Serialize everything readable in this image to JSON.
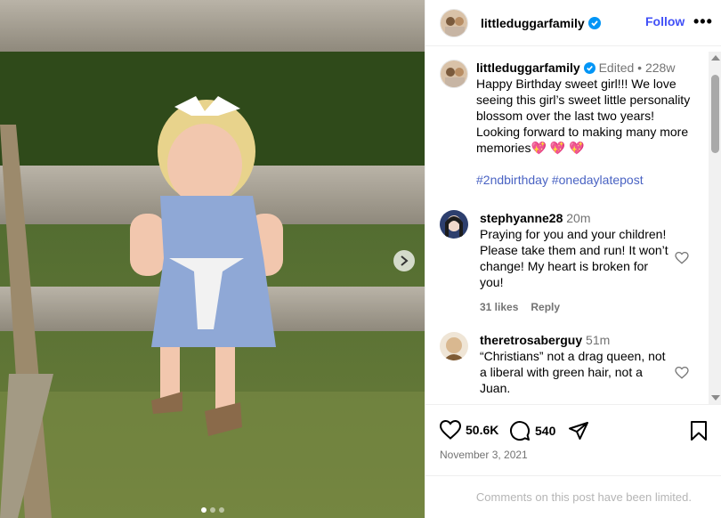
{
  "post": {
    "username": "littleduggarfamily",
    "follow_label": "Follow",
    "more_label": "•••"
  },
  "caption": {
    "username": "littleduggarfamily",
    "edited": "Edited",
    "separator": "•",
    "age": "228w",
    "text": "Happy Birthday sweet girl!!! We love seeing this girl’s sweet little personality blossom over the last two years! Looking forward to making many more memories",
    "emoji": "💖 💖 💖",
    "hashtags": "#2ndbirthday #onedaylatepost"
  },
  "comments": [
    {
      "username": "stephyanne28",
      "age": "20m",
      "text": "Praying for you and your children! Please take them and run! It won’t change! My heart is broken for you!",
      "likes": "31 likes",
      "reply": "Reply"
    },
    {
      "username": "theretrosaberguy",
      "age": "51m",
      "text": "“Christians” not a drag queen, not a liberal with green hair, not a Juan."
    }
  ],
  "stats": {
    "likes": "50.6K",
    "comments": "540"
  },
  "date": "November 3, 2021",
  "limited_notice": "Comments on this post have been limited.",
  "icons": [
    "verified-badge-icon",
    "heart-icon",
    "comment-icon",
    "share-icon",
    "save-icon",
    "chevron-right-icon",
    "more-icon"
  ],
  "colors": {
    "link": "#4150f7",
    "hashtag": "#4a63c3",
    "meta": "#737373",
    "verified": "#0095f6"
  }
}
